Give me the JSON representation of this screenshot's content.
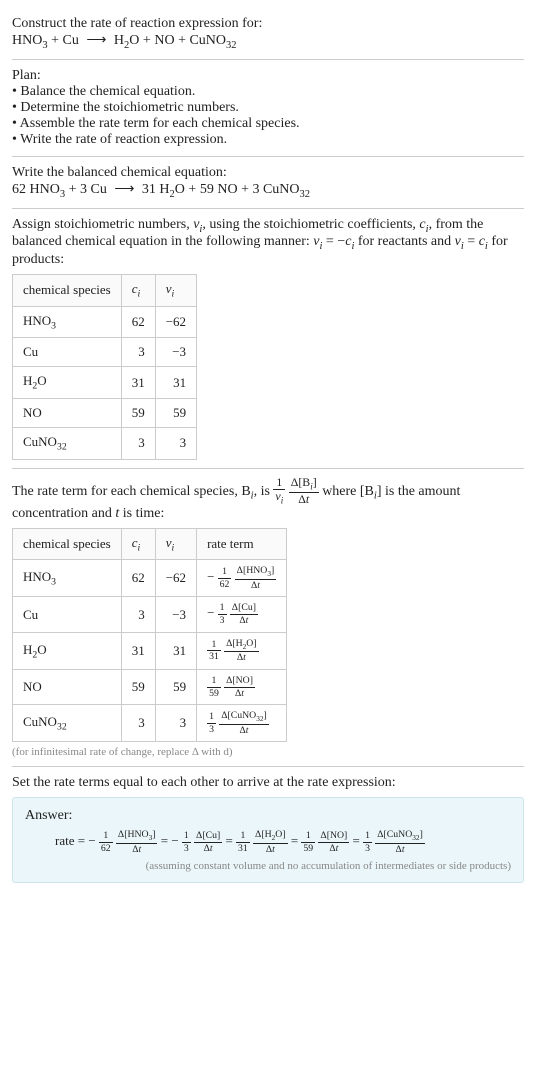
{
  "header": {
    "title": "Construct the rate of reaction expression for:",
    "equation_lhs_1": "HNO",
    "equation_lhs_1_sub": "3",
    "equation_plus": " + ",
    "equation_lhs_2": "Cu",
    "equation_arrow": "⟶",
    "equation_rhs_1": "H",
    "equation_rhs_1_sub": "2",
    "equation_rhs_1b": "O",
    "equation_rhs_2": "NO",
    "equation_rhs_3": "CuNO",
    "equation_rhs_3_sub": "32"
  },
  "plan": {
    "heading": "Plan:",
    "items": [
      "Balance the chemical equation.",
      "Determine the stoichiometric numbers.",
      "Assemble the rate term for each chemical species.",
      "Write the rate of reaction expression."
    ]
  },
  "balanced": {
    "intro": "Write the balanced chemical equation:",
    "c1": "62",
    "s1": "HNO",
    "s1_sub": "3",
    "c2": "3",
    "s2": "Cu",
    "c3": "31",
    "s3a": "H",
    "s3a_sub": "2",
    "s3b": "O",
    "c4": "59",
    "s4": "NO",
    "c5": "3",
    "s5": "CuNO",
    "s5_sub": "32"
  },
  "stoich": {
    "intro_a": "Assign stoichiometric numbers, ",
    "nu": "ν",
    "sub_i": "i",
    "intro_b": ", using the stoichiometric coefficients, ",
    "c": "c",
    "intro_c": ", from the balanced chemical equation in the following manner: ",
    "eq1": " = −",
    "intro_d": " for reactants and ",
    "eq2": " = ",
    "intro_e": " for products:",
    "headers": {
      "species": "chemical species",
      "ci": "c",
      "ci_sub": "i",
      "nui": "ν",
      "nui_sub": "i"
    },
    "rows": [
      {
        "species": "HNO",
        "species_sub": "3",
        "ci": "62",
        "nui": "−62"
      },
      {
        "species": "Cu",
        "species_sub": "",
        "ci": "3",
        "nui": "−3"
      },
      {
        "species": "H",
        "species_sub": "2",
        "species_b": "O",
        "ci": "31",
        "nui": "31"
      },
      {
        "species": "NO",
        "species_sub": "",
        "ci": "59",
        "nui": "59"
      },
      {
        "species": "CuNO",
        "species_sub": "32",
        "ci": "3",
        "nui": "3"
      }
    ]
  },
  "rateterm": {
    "intro_a": "The rate term for each chemical species, B",
    "intro_b": ", is ",
    "intro_c": " where [B",
    "intro_d": "] is the amount concentration and ",
    "t": "t",
    "intro_e": " is time:",
    "headers": {
      "species": "chemical species",
      "ci": "c",
      "ci_sub": "i",
      "nui": "ν",
      "nui_sub": "i",
      "rate": "rate term"
    },
    "rows": [
      {
        "species": "HNO",
        "species_sub": "3",
        "ci": "62",
        "nui": "−62",
        "sign": "−",
        "coef": "62",
        "conc": "HNO",
        "conc_sub": "3"
      },
      {
        "species": "Cu",
        "species_sub": "",
        "ci": "3",
        "nui": "−3",
        "sign": "−",
        "coef": "3",
        "conc": "Cu",
        "conc_sub": ""
      },
      {
        "species": "H",
        "species_sub": "2",
        "species_b": "O",
        "ci": "31",
        "nui": "31",
        "sign": "",
        "coef": "31",
        "conc": "H",
        "conc_sub": "2",
        "conc_b": "O"
      },
      {
        "species": "NO",
        "species_sub": "",
        "ci": "59",
        "nui": "59",
        "sign": "",
        "coef": "59",
        "conc": "NO",
        "conc_sub": ""
      },
      {
        "species": "CuNO",
        "species_sub": "32",
        "ci": "3",
        "nui": "3",
        "sign": "",
        "coef": "3",
        "conc": "CuNO",
        "conc_sub": "32"
      }
    ],
    "note": "(for infinitesimal rate of change, replace Δ with d)"
  },
  "final": {
    "intro": "Set the rate terms equal to each other to arrive at the rate expression:",
    "answer_label": "Answer:",
    "rate_label": "rate = ",
    "eq": " = ",
    "terms": [
      {
        "sign": "−",
        "coef": "62",
        "conc": "HNO",
        "conc_sub": "3"
      },
      {
        "sign": "−",
        "coef": "3",
        "conc": "Cu",
        "conc_sub": ""
      },
      {
        "sign": "",
        "coef": "31",
        "conc": "H",
        "conc_sub": "2",
        "conc_b": "O"
      },
      {
        "sign": "",
        "coef": "59",
        "conc": "NO",
        "conc_sub": ""
      },
      {
        "sign": "",
        "coef": "3",
        "conc": "CuNO",
        "conc_sub": "32"
      }
    ],
    "note": "(assuming constant volume and no accumulation of intermediates or side products)"
  },
  "symbols": {
    "delta": "Δ",
    "one": "1"
  }
}
